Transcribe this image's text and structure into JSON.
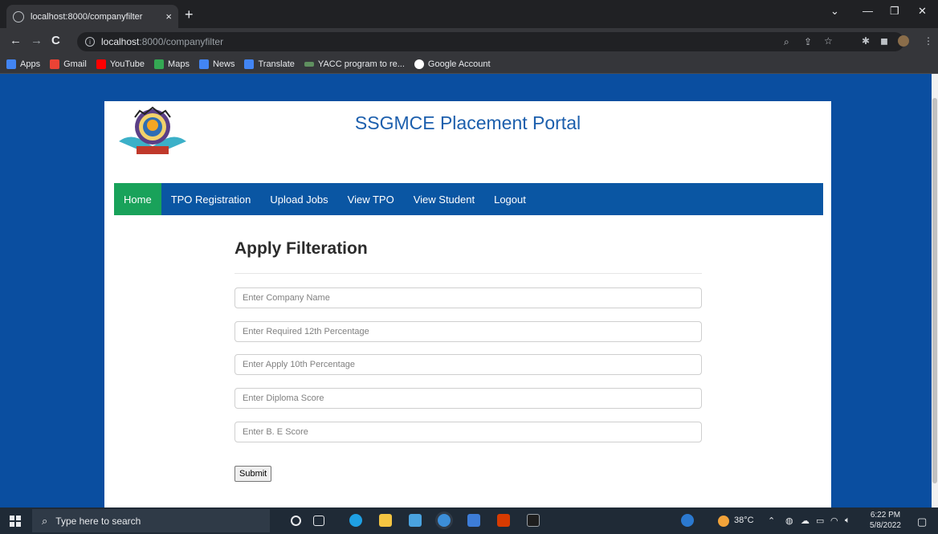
{
  "browser": {
    "tab_title": "localhost:8000/companyfilter",
    "tab_close": "×",
    "new_tab": "+",
    "url_host": "localhost",
    "url_path": ":8000/companyfilter",
    "bookmarks": [
      {
        "label": "Apps",
        "color": "#4285f4"
      },
      {
        "label": "Gmail",
        "color": "#ea4335"
      },
      {
        "label": "YouTube",
        "color": "#ff0000"
      },
      {
        "label": "Maps",
        "color": "#34a853"
      },
      {
        "label": "News",
        "color": "#4285f4"
      },
      {
        "label": "Translate",
        "color": "#4285f4"
      },
      {
        "label": "YACC program to re...",
        "color": "#5f8f5f"
      },
      {
        "label": "Google Account",
        "color": "#ffffff"
      }
    ]
  },
  "site": {
    "title": "SSGMCE Placement Portal",
    "nav": [
      "Home",
      "TPO Registration",
      "Upload Jobs",
      "View TPO",
      "View Student",
      "Logout"
    ]
  },
  "form": {
    "heading": "Apply Filteration",
    "fields": [
      {
        "placeholder": "Enter Company Name"
      },
      {
        "placeholder": "Enter Required 12th Percentage"
      },
      {
        "placeholder": "Enter Apply 10th Percentage"
      },
      {
        "placeholder": "Enter Diploma Score"
      },
      {
        "placeholder": "Enter B. E Score"
      }
    ],
    "submit_label": "Submit"
  },
  "taskbar": {
    "search_placeholder": "Type here to search",
    "weather": "38°C",
    "time": "6:22 PM",
    "date": "5/8/2022"
  },
  "colors": {
    "page_bg": "#0a4ea0",
    "nav_bg": "#0a56a3",
    "nav_active": "#19a25a",
    "title": "#1c5fad"
  }
}
